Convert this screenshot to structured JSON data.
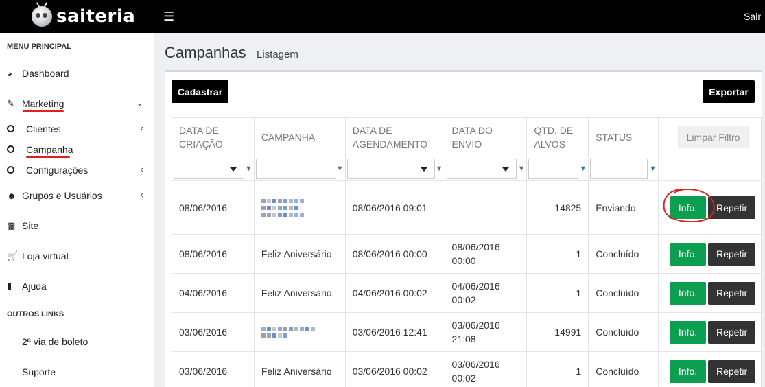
{
  "header": {
    "logo": "saiteria",
    "logout": "Sair"
  },
  "sidebar": {
    "heading_main": "MENU PRINCIPAL",
    "items": [
      {
        "label": "Dashboard",
        "icon": "dashboard-icon"
      },
      {
        "label": "Marketing",
        "icon": "edit-icon"
      },
      {
        "label": "Clientes",
        "icon": "circle-icon"
      },
      {
        "label": "Campanha",
        "icon": "circle-icon"
      },
      {
        "label": "Configurações",
        "icon": "circle-icon"
      },
      {
        "label": "Grupos e Usuários",
        "icon": "users-icon"
      },
      {
        "label": "Site",
        "icon": "inbox-icon"
      },
      {
        "label": "Loja virtual",
        "icon": "cart-icon"
      },
      {
        "label": "Ajuda",
        "icon": "book-icon"
      }
    ],
    "heading_other": "OUTROS LINKS",
    "other_links": [
      {
        "label": "2ª via de boleto",
        "color": "#dd4b39"
      },
      {
        "label": "Suporte",
        "color": "#f39c12"
      }
    ]
  },
  "page": {
    "title": "Campanhas",
    "subtitle": "Listagem"
  },
  "toolbar": {
    "create": "Cadastrar",
    "export": "Exportar"
  },
  "table": {
    "headers": {
      "created": "DATA DE CRIAÇÃO",
      "campaign": "CAMPANHA",
      "scheduled": "DATA DE AGENDAMENTO",
      "sent": "DATA DO ENVIO",
      "qty": "QTD. DE ALVOS",
      "status": "STATUS",
      "clear": "Limpar Filtro"
    },
    "rows": [
      {
        "created": "08/06/2016",
        "campaign": "",
        "scheduled": "08/06/2016 09:01",
        "sent": "",
        "qty": "14825",
        "status": "Enviando"
      },
      {
        "created": "08/06/2016",
        "campaign": "Feliz Aniversário",
        "scheduled": "08/06/2016 00:00",
        "sent": "08/06/2016 00:00",
        "qty": "1",
        "status": "Concluído"
      },
      {
        "created": "04/06/2016",
        "campaign": "Feliz Aniversário",
        "scheduled": "04/06/2016 00:02",
        "sent": "04/06/2016 00:02",
        "qty": "1",
        "status": "Concluído"
      },
      {
        "created": "03/06/2016",
        "campaign": "",
        "scheduled": "03/06/2016 12:41",
        "sent": "03/06/2016 21:08",
        "qty": "14991",
        "status": "Concluído"
      },
      {
        "created": "03/06/2016",
        "campaign": "Feliz Aniversário",
        "scheduled": "03/06/2016 00:02",
        "sent": "03/06/2016 00:02",
        "qty": "1",
        "status": "Concluído"
      }
    ],
    "info_label": "Info.",
    "repeat_label": "Repetir"
  },
  "colors": {
    "info": "#0d9f50",
    "repeat": "#333333",
    "annotation": "#e02020"
  }
}
